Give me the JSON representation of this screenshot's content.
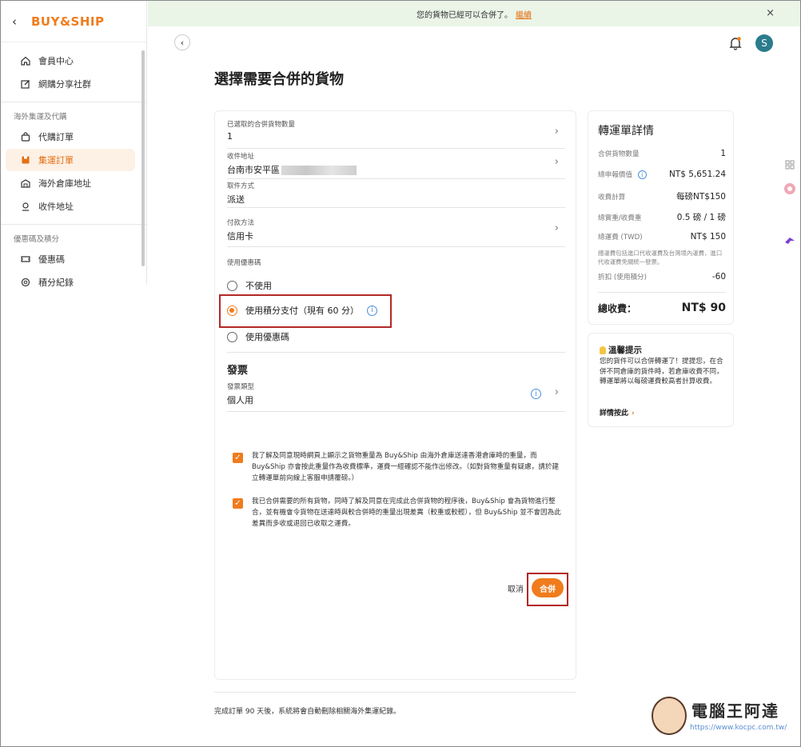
{
  "app": {
    "logo": "BUY&SHIP"
  },
  "sidebar": {
    "items_top": [
      {
        "label": "會員中心"
      },
      {
        "label": "網購分享社群"
      }
    ],
    "section1": "海外集運及代購",
    "items_mid": [
      {
        "label": "代購訂單"
      },
      {
        "label": "集運訂單"
      },
      {
        "label": "海外倉庫地址"
      },
      {
        "label": "收件地址"
      }
    ],
    "section2": "優惠碼及積分",
    "items_bot": [
      {
        "label": "優惠碼"
      },
      {
        "label": "積分紀錄"
      }
    ]
  },
  "banner": {
    "text": "您的貨物已經可以合併了。",
    "link": "繼續",
    "close": "×"
  },
  "header": {
    "avatar": "S"
  },
  "page": {
    "title": "選擇需要合併的貨物"
  },
  "form": {
    "selected_count_label": "已選取的合併貨物數量",
    "selected_count": "1",
    "address_label": "收件地址",
    "address_value": "台南市安平區",
    "pickup_label": "取件方式",
    "pickup_value": "派送",
    "payment_label": "付款方法",
    "payment_value": "信用卡",
    "coupon_label": "使用優惠碼",
    "opt_none": "不使用",
    "opt_points": "使用積分支付（現有 60 分）",
    "opt_coupon": "使用優惠碼",
    "invoice_heading": "發票",
    "invoice_type_label": "發票類型",
    "invoice_type_value": "個人用",
    "agree1": "我了解及同意現時網頁上顯示之貨物重量為 Buy&Ship 由海外倉庫送達香港倉庫時的重量，而 Buy&Ship 亦會按此重量作為收費標準，運費一經確認不能作出修改。（如對貨物重量有疑慮，請於建立轉運單前向線上客服申請覆磅。）",
    "agree2": "我已合併需要的所有貨物，同時了解及同意在完成此合併貨物的程序後，Buy&Ship 會為貨物進行整合，並有機會令貨物在送達時與較合併時的重量出現差異（較重或較輕），但 Buy&Ship 並不會因為此差異而多收或退回已收取之運費。",
    "cancel": "取消",
    "merge": "合併"
  },
  "footer": {
    "note": "完成訂單 90 天後，系統將會自動刪除相關海外集運紀錄。"
  },
  "summary": {
    "title": "轉運單詳情",
    "rows": [
      {
        "k": "合併貨物數量",
        "v": "1"
      },
      {
        "k": "總申報價值",
        "v": "NT$ 5,651.24"
      },
      {
        "k": "收費計算",
        "v": "每磅NT$150"
      },
      {
        "k": "總實重/收費重",
        "v": "0.5 磅 / 1 磅"
      },
      {
        "k": "總運費 (TWD)",
        "v": "NT$ 150"
      },
      {
        "k": "折扣 (使用積分)",
        "v": "-60"
      }
    ],
    "note": "總運費包括進口代收運費及台灣境內運費，進口代收運費免關統一發票。",
    "total_label": "總收費：",
    "total_value": "NT$ 90"
  },
  "tip": {
    "title": "溫馨提示",
    "body": "您的貨件可以合併轉運了！提提您，在合併不同倉庫的貨件時，若倉庫收費不同，轉運單將以每磅運費較高者計算收費。",
    "link": "詳情按此"
  },
  "watermark": {
    "name": "電腦王阿達",
    "url": "https://www.kocpc.com.tw/"
  }
}
